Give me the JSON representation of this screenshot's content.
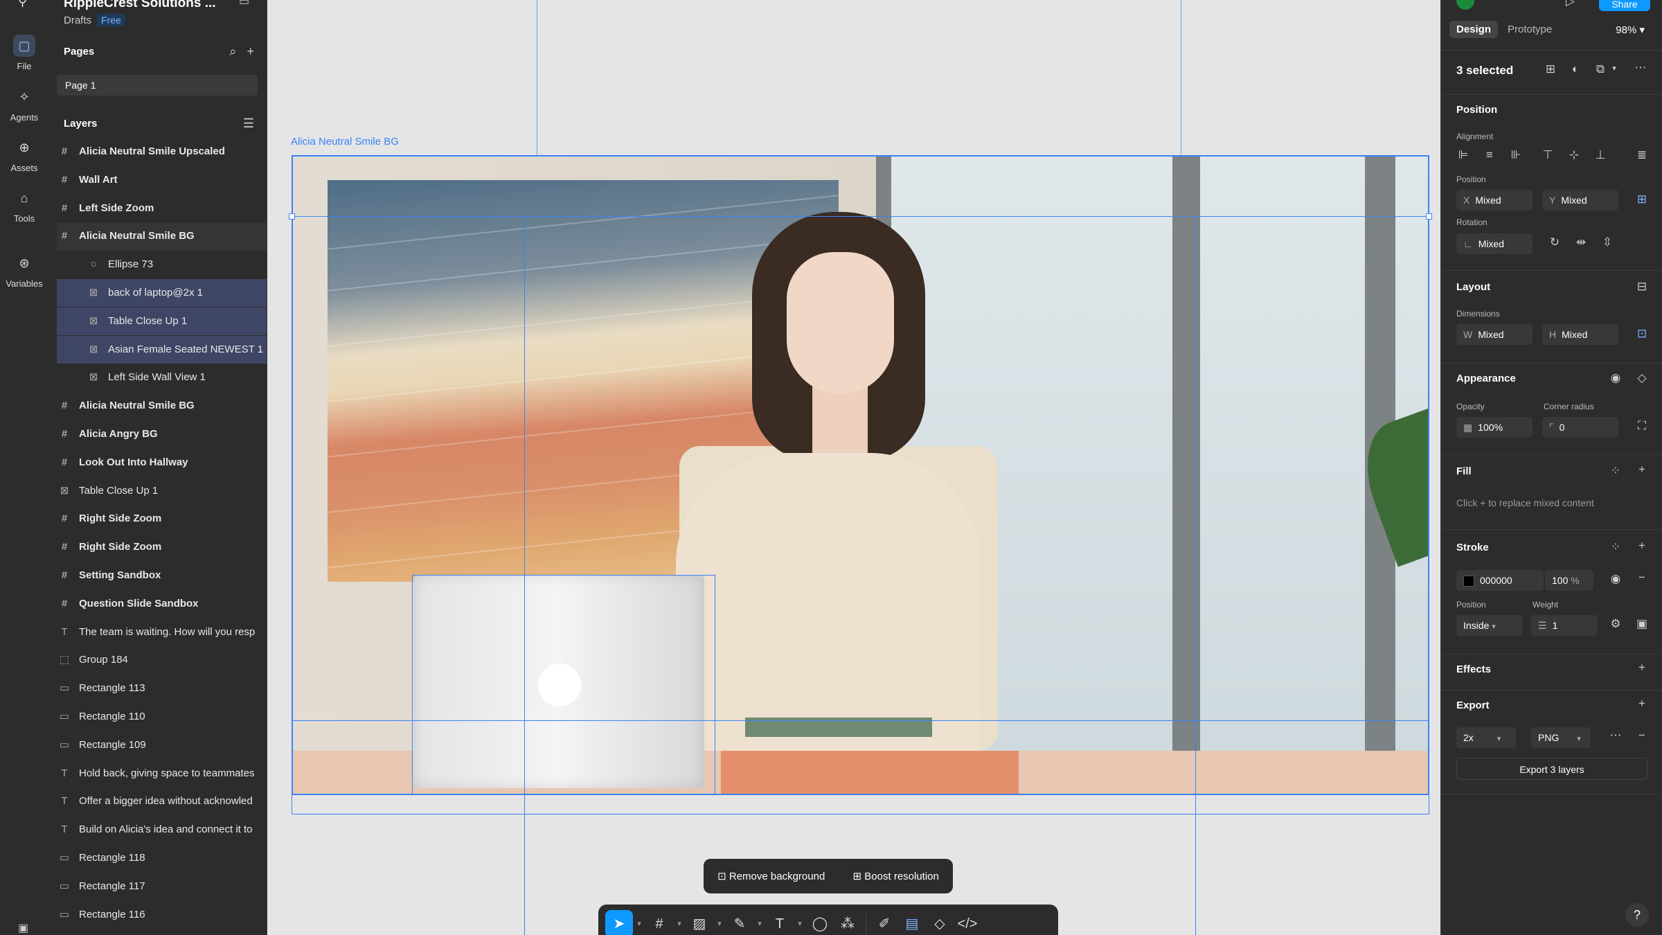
{
  "rail": {
    "items": [
      {
        "label": "File",
        "icon": "file-icon"
      },
      {
        "label": "Agents",
        "icon": "agents-icon"
      },
      {
        "label": "Assets",
        "icon": "assets-icon"
      },
      {
        "label": "Tools",
        "icon": "tools-icon"
      },
      {
        "label": "Variables",
        "icon": "variables-icon"
      }
    ]
  },
  "header": {
    "project_title": "RippleCrest Solutions ...",
    "location": "Drafts",
    "plan_badge": "Free"
  },
  "pages": {
    "title": "Pages",
    "items": [
      "Page 1"
    ]
  },
  "layers": {
    "title": "Layers",
    "items": [
      {
        "name": "Alicia Neutral Smile Upscaled",
        "type": "frame"
      },
      {
        "name": "Wall Art",
        "type": "frame"
      },
      {
        "name": "Left Side Zoom",
        "type": "frame"
      },
      {
        "name": "Alicia Neutral Smile BG",
        "type": "frame"
      },
      {
        "name": "Ellipse 73",
        "type": "ellipse"
      },
      {
        "name": "back of laptop@2x 1",
        "type": "image"
      },
      {
        "name": "Table Close Up 1",
        "type": "image"
      },
      {
        "name": "Asian Female Seated NEWEST 1",
        "type": "image"
      },
      {
        "name": "Left Side Wall View 1",
        "type": "image"
      },
      {
        "name": "Alicia Neutral Smile BG",
        "type": "frame"
      },
      {
        "name": "Alicia Angry BG",
        "type": "frame"
      },
      {
        "name": "Look Out Into Hallway",
        "type": "frame"
      },
      {
        "name": "Table Close Up 1",
        "type": "image"
      },
      {
        "name": "Right Side Zoom",
        "type": "frame"
      },
      {
        "name": "Right Side Zoom",
        "type": "frame"
      },
      {
        "name": "Setting Sandbox",
        "type": "frame"
      },
      {
        "name": "Question Slide Sandbox",
        "type": "frame"
      },
      {
        "name": "The team is waiting. How will you resp",
        "type": "text"
      },
      {
        "name": "Group 184",
        "type": "group"
      },
      {
        "name": "Rectangle 113",
        "type": "rect"
      },
      {
        "name": "Rectangle 110",
        "type": "rect"
      },
      {
        "name": "Rectangle 109",
        "type": "rect"
      },
      {
        "name": "Hold back, giving space to teammates",
        "type": "text"
      },
      {
        "name": "Offer a bigger idea without acknowled",
        "type": "text"
      },
      {
        "name": "Build on Alicia's idea and connect it to",
        "type": "text"
      },
      {
        "name": "Rectangle 118",
        "type": "rect"
      },
      {
        "name": "Rectangle 117",
        "type": "rect"
      },
      {
        "name": "Rectangle 116",
        "type": "rect"
      }
    ]
  },
  "canvas": {
    "frame_label": "Alicia Neutral Smile BG"
  },
  "ai_actions": {
    "remove_bg": "Remove background",
    "boost": "Boost resolution"
  },
  "right": {
    "share": "Share",
    "tabs": [
      "Design",
      "Prototype"
    ],
    "zoom": "98%",
    "selection": "3 selected",
    "position": {
      "title": "Position",
      "alignment_label": "Alignment",
      "position_label": "Position",
      "x_prefix": "X",
      "x": "Mixed",
      "y_prefix": "Y",
      "y": "Mixed",
      "rotation_label": "Rotation",
      "rotation": "Mixed"
    },
    "layout": {
      "title": "Layout",
      "dimensions_label": "Dimensions",
      "w_prefix": "W",
      "w": "Mixed",
      "h_prefix": "H",
      "h": "Mixed"
    },
    "appearance": {
      "title": "Appearance",
      "opacity_label": "Opacity",
      "opacity": "100%",
      "radius_label": "Corner radius",
      "radius": "0"
    },
    "fill": {
      "title": "Fill",
      "note": "Click + to replace mixed content"
    },
    "stroke": {
      "title": "Stroke",
      "color": "000000",
      "opacity": "100",
      "pct": "%",
      "position_label": "Position",
      "position": "Inside",
      "weight_label": "Weight",
      "weight": "1"
    },
    "effects": {
      "title": "Effects"
    },
    "export": {
      "title": "Export",
      "scale": "2x",
      "format": "PNG",
      "button": "Export 3 layers"
    }
  },
  "colors": {
    "accent": "#0d99ff",
    "selection": "#3b82f6",
    "panel": "#2c2c2c"
  }
}
